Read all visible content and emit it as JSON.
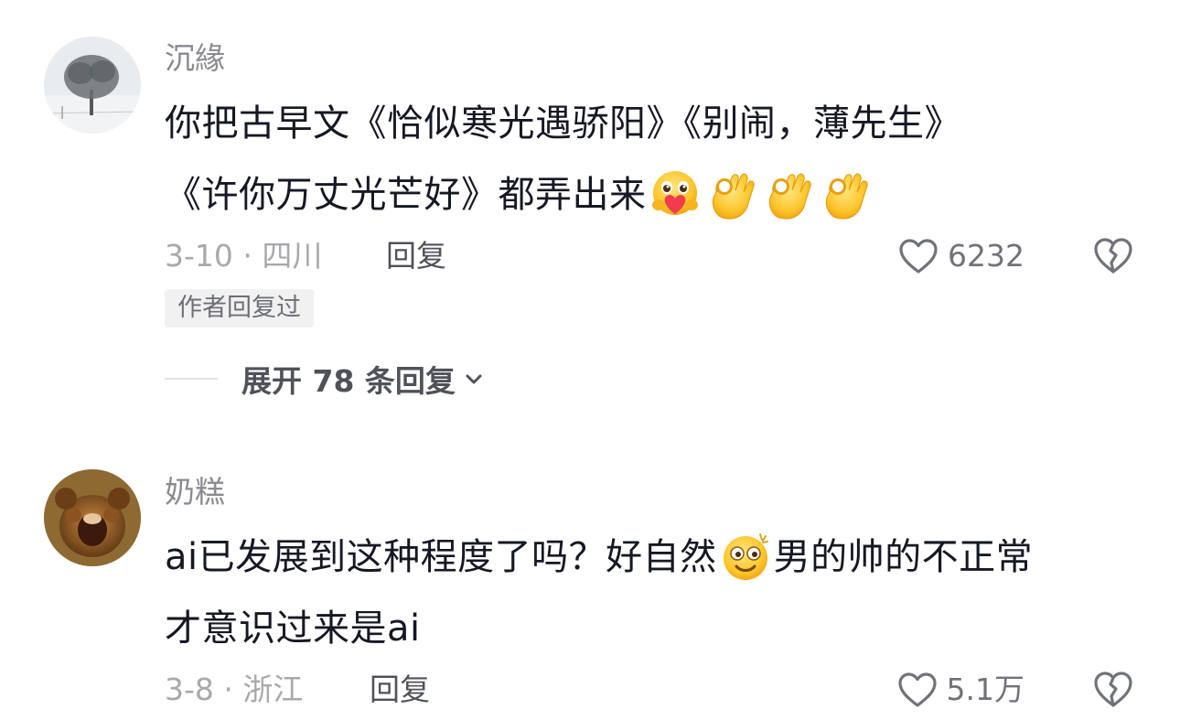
{
  "comments": [
    {
      "username": "沉緣",
      "text_line1": "你把古早文《恰似寒光遇骄阳》《别闹，薄先生》",
      "text_line2": "《许你万丈光芒好》都弄出来",
      "line2_emojis": [
        "hugging-heart-emoji",
        "ok-hand-emoji",
        "ok-hand-emoji",
        "ok-hand-emoji"
      ],
      "date_location": "3-10 · 四川",
      "reply_label": "回复",
      "like_count": "6232",
      "author_badge": "作者回复过",
      "expand_replies_label": "展开 78 条回复"
    },
    {
      "username": "奶糕",
      "text_line1_part1": "ai已发展到这种程度了吗？好自然",
      "text_line1_emoji": "dizzy-smile-emoji",
      "text_line1_part2": "男的帅的不正常",
      "text_line2": "才意识过来是ai",
      "date_location": "3-8 · 浙江",
      "reply_label": "回复",
      "like_count": "5.1万"
    }
  ],
  "icons": {
    "like": "heart-outline-icon",
    "dislike": "broken-heart-icon",
    "expand": "chevron-down-icon"
  },
  "colors": {
    "username": "#8a8b91",
    "text": "#161823",
    "meta": "#a8a9ad",
    "reply": "#505259",
    "badge_bg": "#f1f1f2"
  }
}
